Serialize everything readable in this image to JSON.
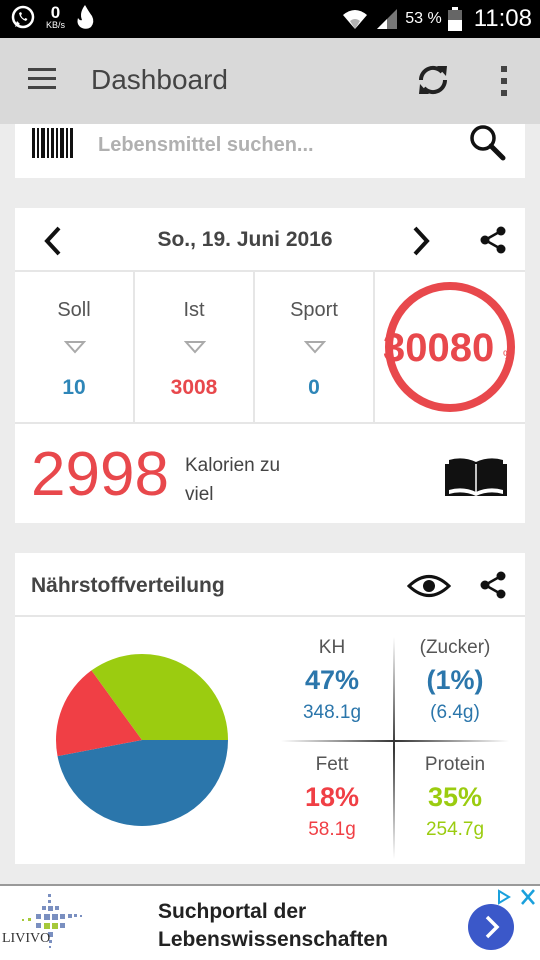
{
  "status_bar": {
    "net_speed": "0",
    "net_unit": "KB/s",
    "battery": "53 %",
    "time": "11:08"
  },
  "app_bar": {
    "title": "Dashboard"
  },
  "search": {
    "placeholder": "Lebensmittel suchen..."
  },
  "calorie_card": {
    "date": "So., 19. Juni 2016",
    "stats": [
      {
        "label": "Soll",
        "value": "10",
        "color": "#2e86b8"
      },
      {
        "label": "Ist",
        "value": "3008",
        "color": "#e8484c"
      },
      {
        "label": "Sport",
        "value": "0",
        "color": "#2e86b8"
      }
    ],
    "percent": "30080",
    "percent_unit": "%",
    "excess_value": "2998",
    "excess_label": "Kalorien zu viel"
  },
  "nutrients": {
    "title": "Nährstoffverteilung",
    "items": [
      {
        "name": "KH",
        "percent": "47%",
        "grams": "348.1g",
        "color": "#2b76ab",
        "fraction": 0.47
      },
      {
        "name": "(Zucker)",
        "percent": "(1%)",
        "grams": "(6.4g)",
        "color": "#2b76ab"
      },
      {
        "name": "Fett",
        "percent": "18%",
        "grams": "58.1g",
        "color": "#f03f45",
        "fraction": 0.18
      },
      {
        "name": "Protein",
        "percent": "35%",
        "grams": "254.7g",
        "color": "#9bcc10",
        "fraction": 0.35
      }
    ]
  },
  "ad": {
    "logo_text": "LIVIVO",
    "line1": "Suchportal der",
    "line2": "Lebenswissenschaften",
    "choices_label": "▷",
    "close_label": "X",
    "accent": "#3b58c9"
  }
}
